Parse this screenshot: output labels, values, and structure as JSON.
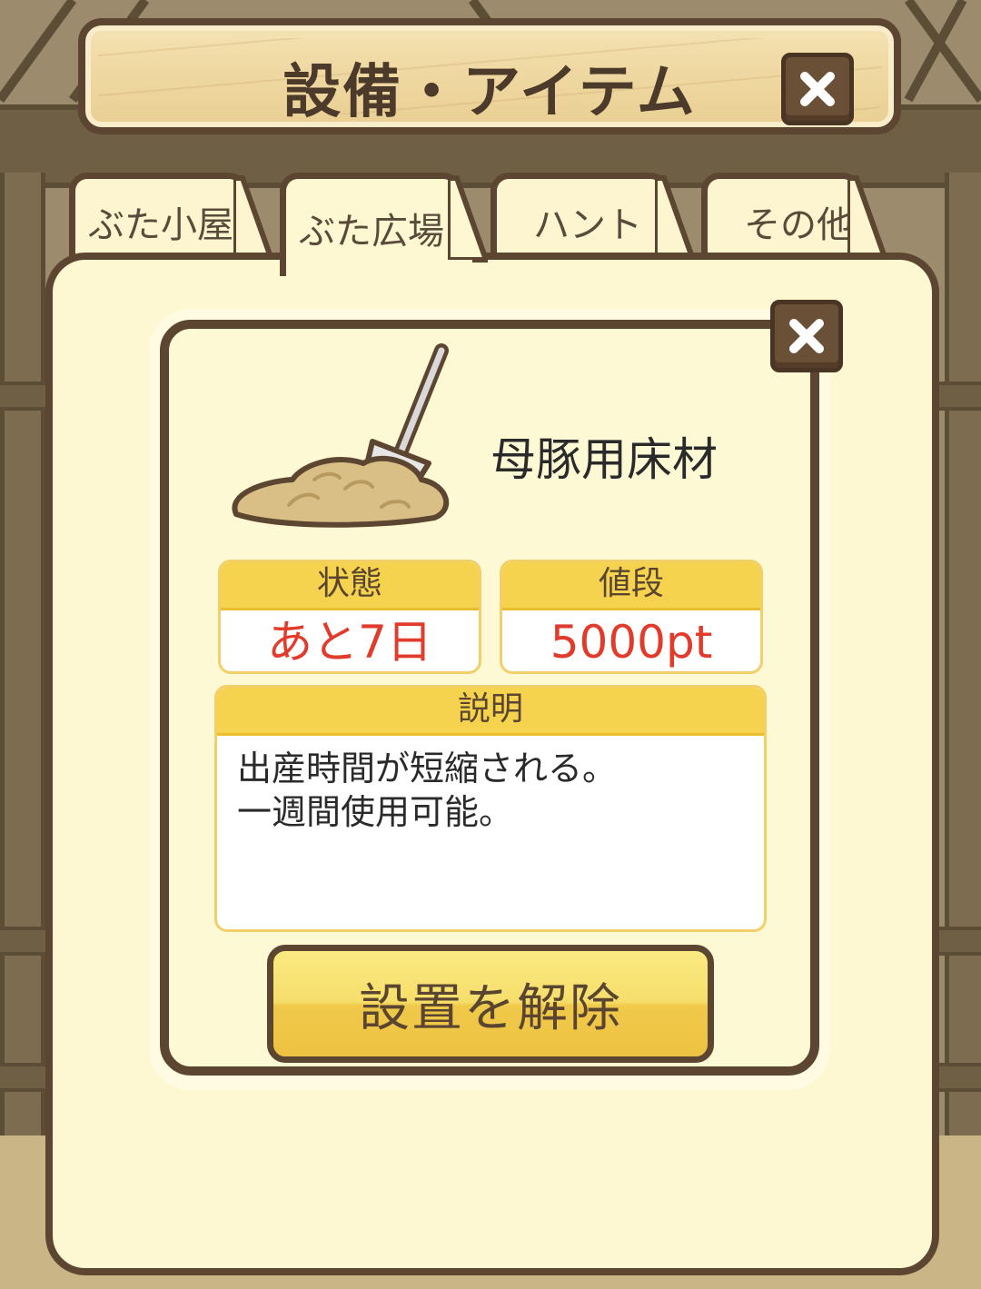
{
  "header": {
    "title": "設備・アイテム",
    "close_icon": "close-icon"
  },
  "tabs": [
    {
      "label": "ぶた小屋",
      "active": false
    },
    {
      "label": "ぶた広場",
      "active": true
    },
    {
      "label": "ハント",
      "active": false
    },
    {
      "label": "その他",
      "active": false
    }
  ],
  "item": {
    "name": "母豚用床材",
    "icon": "bedding-shovel-icon",
    "status": {
      "label": "状態",
      "value": "あと7日"
    },
    "price": {
      "label": "値段",
      "value": "5000pt"
    },
    "description": {
      "label": "説明",
      "text": "出産時間が短縮される。\n一週間使用可能。"
    }
  },
  "actions": {
    "remove_label": "設置を解除"
  },
  "colors": {
    "frame": "#5d4631",
    "panel": "#fdf8d2",
    "accent": "#f5d34e",
    "value_red": "#e23b2b"
  }
}
